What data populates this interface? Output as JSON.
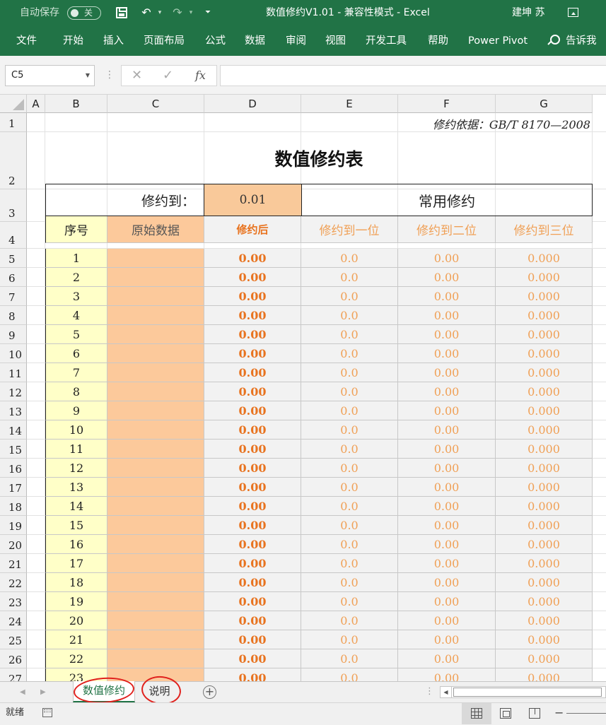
{
  "titlebar": {
    "autosave_label": "自动保存",
    "autosave_state": "关",
    "window_title": "数值修约V1.01  -  兼容性模式  -  Excel",
    "user_name": "建坤 苏"
  },
  "ribbon": {
    "tabs": [
      "文件",
      "开始",
      "插入",
      "页面布局",
      "公式",
      "数据",
      "审阅",
      "视图",
      "开发工具",
      "帮助",
      "Power Pivot"
    ],
    "tell_me": "告诉我"
  },
  "formula_bar": {
    "name_box": "C5",
    "formula": ""
  },
  "grid": {
    "columns": [
      "A",
      "B",
      "C",
      "D",
      "E",
      "F",
      "G"
    ],
    "rows": [
      "1",
      "2",
      "3",
      "4",
      "5",
      "6",
      "7",
      "8",
      "9",
      "10",
      "11",
      "12",
      "13",
      "14",
      "15",
      "16",
      "17",
      "18",
      "19",
      "20",
      "21",
      "22",
      "23",
      "24",
      "25",
      "26",
      "27"
    ]
  },
  "sheet": {
    "note": "修约依据：GB/T 8170—2008",
    "title": "数值修约表",
    "setting_label": "修约到：",
    "setting_value": "0.01",
    "common_label": "常用修约",
    "headers": {
      "seq": "序号",
      "original": "原始数据",
      "rounded": "修约后",
      "round_1": "修约到一位",
      "round_2": "修约到二位",
      "round_3": "修约到三位"
    },
    "row_values": {
      "rounded": "0.00",
      "round_1": "0.0",
      "round_2": "0.00",
      "round_3": "0.000"
    },
    "seq_numbers": [
      1,
      2,
      3,
      4,
      5,
      6,
      7,
      8,
      9,
      10,
      11,
      12,
      13,
      14,
      15,
      16,
      17,
      18,
      19,
      20,
      21,
      22,
      23
    ]
  },
  "sheet_tabs": {
    "active": "数值修约",
    "second": "说明"
  },
  "status": {
    "ready": "就绪"
  },
  "colors": {
    "excel_green": "#217346",
    "input_orange": "#fcc99b",
    "seq_yellow": "#ffffc8",
    "result_orange": "#e8731f",
    "annotation_red": "#e0201c"
  }
}
